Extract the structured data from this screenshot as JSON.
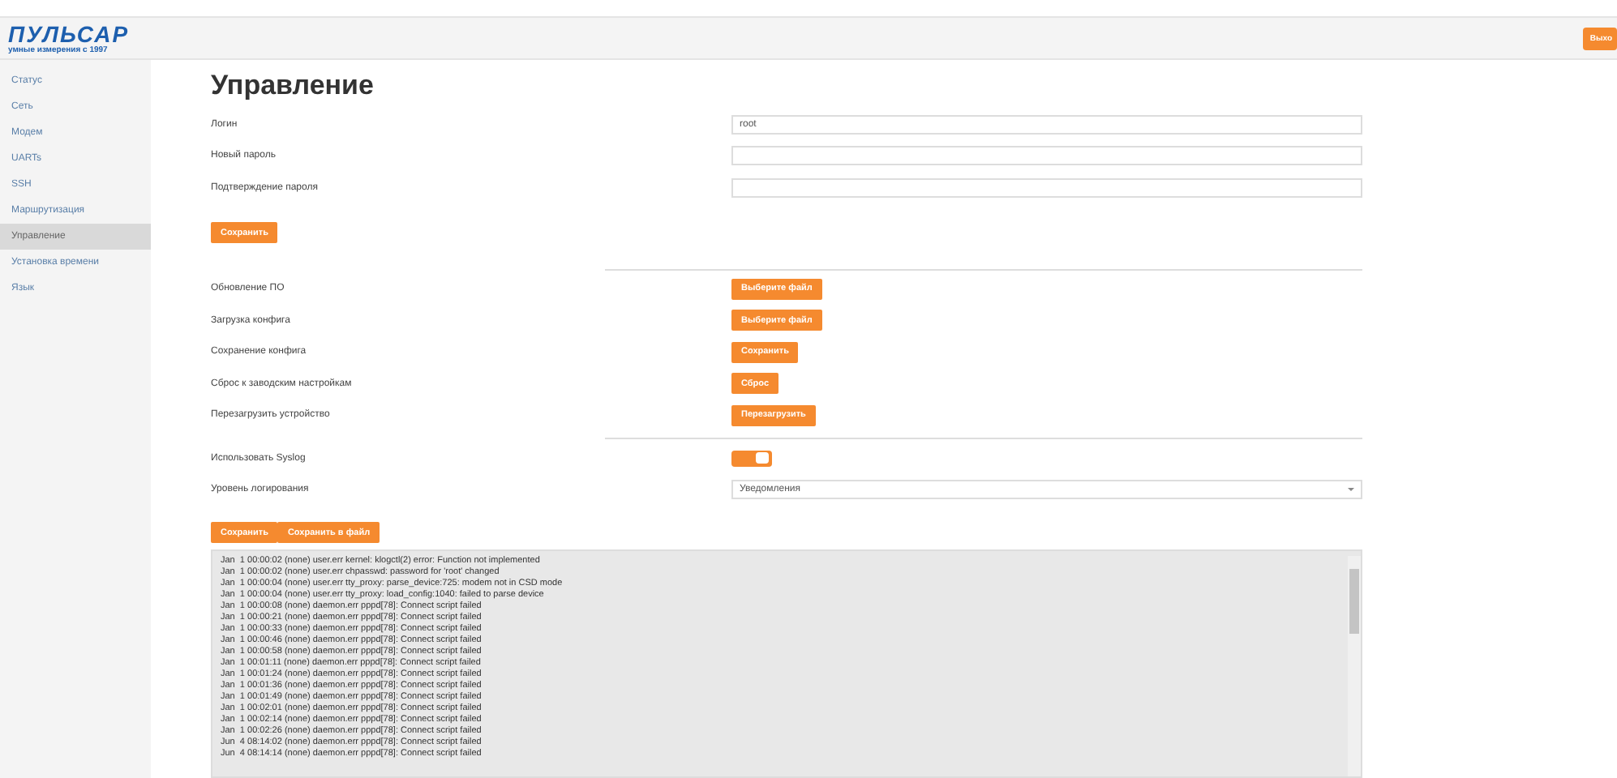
{
  "header": {
    "logo_name": "ПУЛЬСАР",
    "logo_tagline": "умные измерения с 1997",
    "logout_button": "Выхо"
  },
  "sidebar": {
    "items": [
      {
        "label": "Статус",
        "selected": false
      },
      {
        "label": "Сеть",
        "selected": false
      },
      {
        "label": "Модем",
        "selected": false
      },
      {
        "label": "UARTs",
        "selected": false
      },
      {
        "label": "SSH",
        "selected": false
      },
      {
        "label": "Маршрутизация",
        "selected": false
      },
      {
        "label": "Управление",
        "selected": true
      },
      {
        "label": "Установка времени",
        "selected": false
      },
      {
        "label": "Язык",
        "selected": false
      }
    ]
  },
  "title": "Управление",
  "fields": [
    {
      "label": "Логин",
      "value": "root"
    },
    {
      "label": "Новый пароль"
    },
    {
      "label": "Подтверждение пароля"
    }
  ],
  "save_button": "Сохранить",
  "actions": [
    {
      "label": "Обновление ПО",
      "button": "Выберите файл"
    },
    {
      "label": "Загрузка конфига",
      "button": "Выберите файл"
    },
    {
      "label": "Сохранение конфига",
      "button": "Сохранить"
    },
    {
      "label": "Сброс к заводским настройкам",
      "button": "Сброс"
    },
    {
      "label": "Перезагрузить устройство",
      "button": "Перезагрузить"
    }
  ],
  "syslog": {
    "label": "Использовать Syslog",
    "on": true
  },
  "log_level": {
    "label": "Уровень логирования",
    "value": "Уведомления"
  },
  "log_buttons": [
    "Сохранить",
    "Сохранить в файл"
  ],
  "log_lines": [
    "Jan  1 00:00:02 (none) user.err kernel: klogctl(2) error: Function not implemented",
    "Jan  1 00:00:02 (none) user.err chpasswd: password for 'root' changed",
    "Jan  1 00:00:04 (none) user.err tty_proxy: parse_device:725: modem not in CSD mode",
    "Jan  1 00:00:04 (none) user.err tty_proxy: load_config:1040: failed to parse device",
    "Jan  1 00:00:08 (none) daemon.err pppd[78]: Connect script failed",
    "Jan  1 00:00:21 (none) daemon.err pppd[78]: Connect script failed",
    "Jan  1 00:00:33 (none) daemon.err pppd[78]: Connect script failed",
    "Jan  1 00:00:46 (none) daemon.err pppd[78]: Connect script failed",
    "Jan  1 00:00:58 (none) daemon.err pppd[78]: Connect script failed",
    "Jan  1 00:01:11 (none) daemon.err pppd[78]: Connect script failed",
    "Jan  1 00:01:24 (none) daemon.err pppd[78]: Connect script failed",
    "Jan  1 00:01:36 (none) daemon.err pppd[78]: Connect script failed",
    "Jan  1 00:01:49 (none) daemon.err pppd[78]: Connect script failed",
    "Jan  1 00:02:01 (none) daemon.err pppd[78]: Connect script failed",
    "Jan  1 00:02:14 (none) daemon.err pppd[78]: Connect script failed",
    "Jan  1 00:02:26 (none) daemon.err pppd[78]: Connect script failed",
    "Jun  4 08:14:02 (none) daemon.err pppd[78]: Connect script failed",
    "Jun  4 08:14:14 (none) daemon.err pppd[78]: Connect script failed"
  ]
}
